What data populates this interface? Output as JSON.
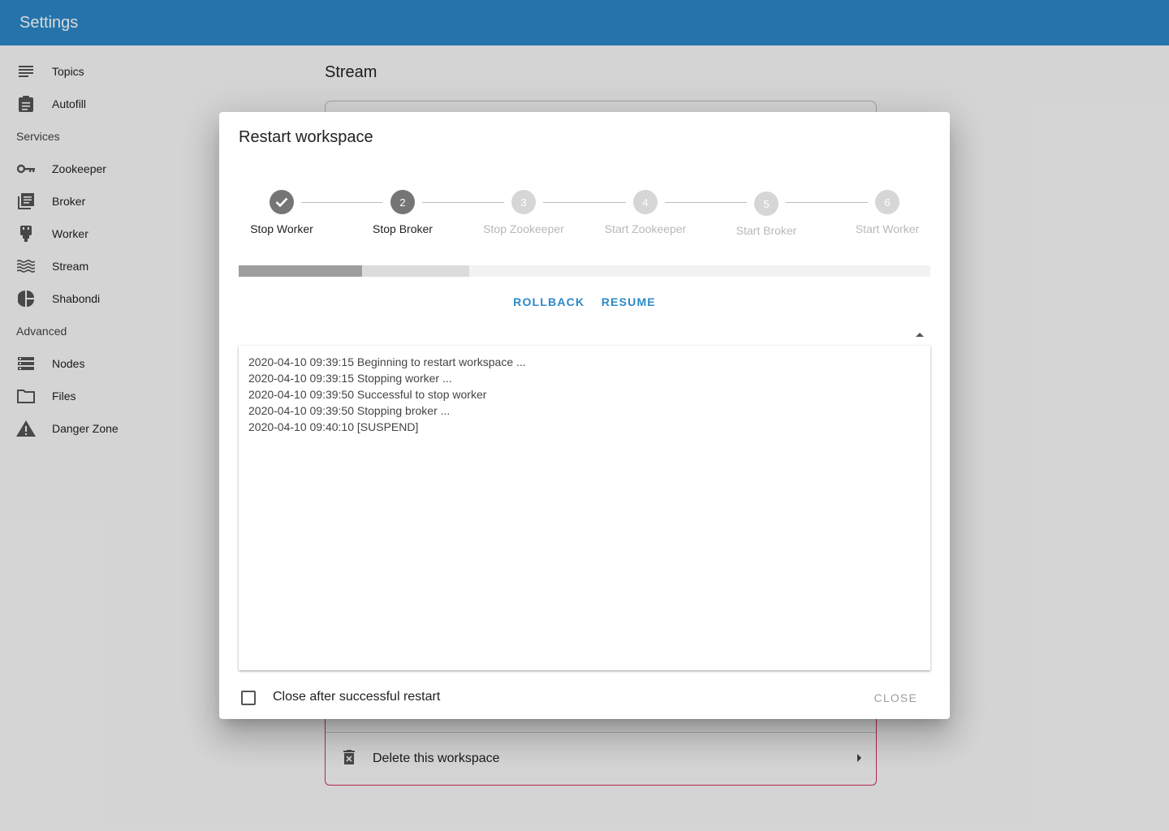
{
  "appbar": {
    "title": "Settings"
  },
  "sidebar": {
    "items": [
      {
        "label": "Topics",
        "icon": "list-icon"
      },
      {
        "label": "Autofill",
        "icon": "clipboard-icon"
      }
    ],
    "services_title": "Services",
    "services": [
      {
        "label": "Zookeeper",
        "icon": "key-icon"
      },
      {
        "label": "Broker",
        "icon": "library-icon"
      },
      {
        "label": "Worker",
        "icon": "plug-icon"
      },
      {
        "label": "Stream",
        "icon": "waves-icon"
      },
      {
        "label": "Shabondi",
        "icon": "pie-chart-icon"
      }
    ],
    "advanced_title": "Advanced",
    "advanced": [
      {
        "label": "Nodes",
        "icon": "storage-icon"
      },
      {
        "label": "Files",
        "icon": "folder-icon"
      },
      {
        "label": "Danger Zone",
        "icon": "warning-icon"
      }
    ]
  },
  "main": {
    "title": "Stream",
    "danger": {
      "delete_label": "Delete this workspace"
    }
  },
  "dialog": {
    "title": "Restart workspace",
    "steps": [
      {
        "label": "Stop Worker",
        "state": "done",
        "number": "1"
      },
      {
        "label": "Stop Broker",
        "state": "active",
        "number": "2"
      },
      {
        "label": "Stop Zookeeper",
        "state": "pending",
        "number": "3"
      },
      {
        "label": "Start Zookeeper",
        "state": "pending",
        "number": "4"
      },
      {
        "label": "Start Broker",
        "state": "pending",
        "number": "5"
      },
      {
        "label": "Start Worker",
        "state": "pending",
        "number": "6"
      }
    ],
    "progress": {
      "value": 0.1784,
      "buffer": 0.3333
    },
    "rollback_label": "ROLLBACK",
    "resume_label": "RESUME",
    "log": [
      "2020-04-10 09:39:15 Beginning to restart workspace ...",
      "2020-04-10 09:39:15 Stopping worker ...",
      "2020-04-10 09:39:50 Successful to stop worker",
      "2020-04-10 09:39:50 Stopping broker ...",
      "2020-04-10 09:40:10 [SUSPEND]"
    ],
    "close_after_label": "Close after successful restart",
    "close_after_checked": false,
    "close_label": "CLOSE"
  },
  "colors": {
    "primary": "#2b89c9",
    "danger": "#d32f5a",
    "step_active": "#757575",
    "step_pending": "#d6d6d6"
  }
}
